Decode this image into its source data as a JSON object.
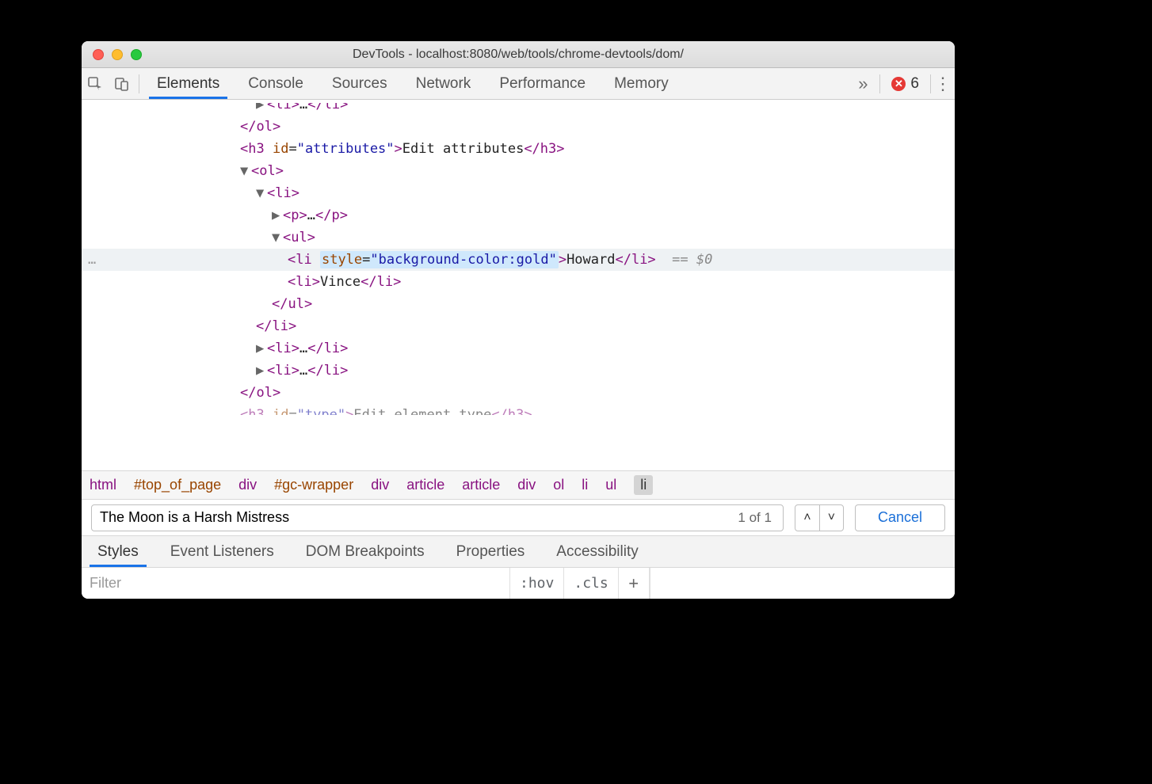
{
  "titlebar": {
    "title": "DevTools - localhost:8080/web/tools/chrome-devtools/dom/"
  },
  "toolbar": {
    "tabs": [
      "Elements",
      "Console",
      "Sources",
      "Network",
      "Performance",
      "Memory"
    ],
    "active_tab": "Elements",
    "overflow_glyph": "»",
    "error_count": "6"
  },
  "dom": {
    "lines": [
      {
        "indent": 220,
        "tri": "▶",
        "open": "<li>",
        "mid": "…",
        "close": "</li>",
        "cutoff_top": true
      },
      {
        "indent": 200,
        "close_only": "</ol>"
      },
      {
        "indent": 200,
        "raw": "<h3 id=\"attributes\">Edit attributes</h3>",
        "render": "h3attr"
      },
      {
        "indent": 200,
        "tri": "▼",
        "open": "<ol>"
      },
      {
        "indent": 220,
        "tri": "▼",
        "open": "<li>"
      },
      {
        "indent": 240,
        "tri": "▶",
        "open": "<p>",
        "mid": "…",
        "close": "</p>"
      },
      {
        "indent": 240,
        "tri": "▼",
        "open": "<ul>"
      },
      {
        "indent": 260,
        "highlight": true,
        "render": "selected_li",
        "attr_text": "style=\"background-color:gold\"",
        "text": "Howard",
        "seleq": "== $0"
      },
      {
        "indent": 260,
        "open": "<li>",
        "text": "Vince",
        "close": "</li>"
      },
      {
        "indent": 240,
        "close_only": "</ul>"
      },
      {
        "indent": 220,
        "close_only": "</li>"
      },
      {
        "indent": 220,
        "tri": "▶",
        "open": "<li>",
        "mid": "…",
        "close": "</li>"
      },
      {
        "indent": 220,
        "tri": "▶",
        "open": "<li>",
        "mid": "…",
        "close": "</li>"
      },
      {
        "indent": 200,
        "close_only": "</ol>"
      },
      {
        "indent": 200,
        "render": "h3type_cut"
      }
    ]
  },
  "breadcrumb": {
    "items": [
      "html",
      "#top_of_page",
      "div",
      "#gc-wrapper",
      "div",
      "article",
      "article",
      "div",
      "ol",
      "li",
      "ul",
      "li"
    ],
    "selected_index": 11
  },
  "search": {
    "value": "The Moon is a Harsh Mistress",
    "result": "1 of 1",
    "cancel": "Cancel"
  },
  "subtabs": {
    "items": [
      "Styles",
      "Event Listeners",
      "DOM Breakpoints",
      "Properties",
      "Accessibility"
    ],
    "active": "Styles"
  },
  "filter": {
    "placeholder": "Filter",
    "hov": ":hov",
    "cls": ".cls"
  }
}
